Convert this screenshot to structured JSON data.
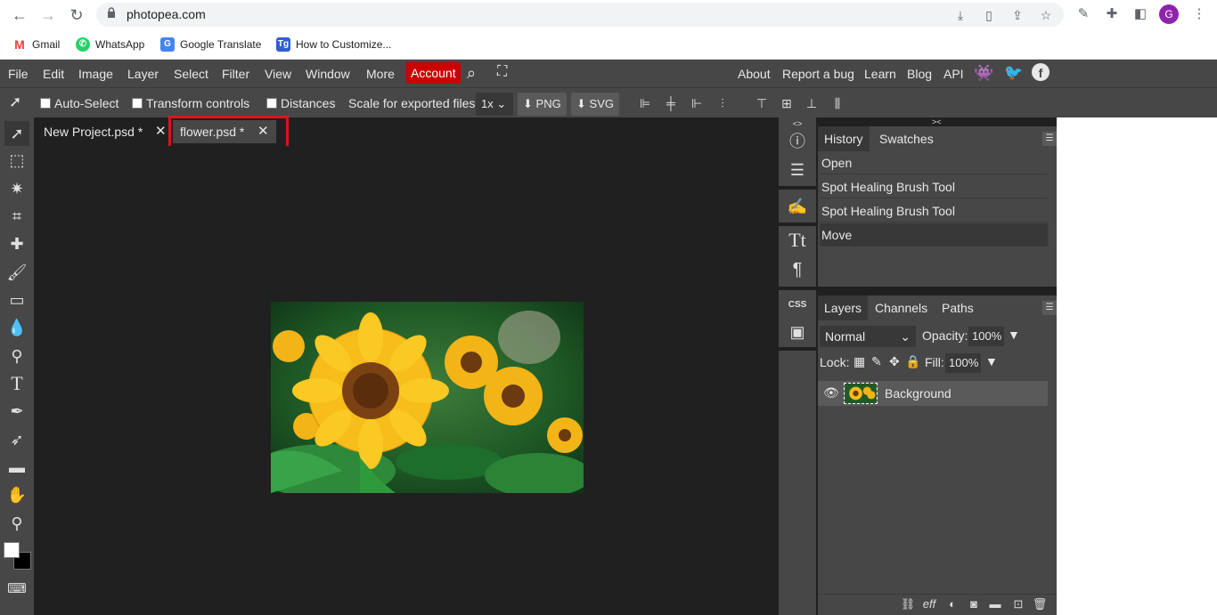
{
  "browser": {
    "url": "photopea.com",
    "profile_initial": "G",
    "bookmarks": [
      {
        "label": "Gmail",
        "icon": "gmail-icon",
        "color": "#ea4335"
      },
      {
        "label": "WhatsApp",
        "icon": "whatsapp-icon",
        "color": "#25d366"
      },
      {
        "label": "Google Translate",
        "icon": "google-translate-icon",
        "color": "#4285f4"
      },
      {
        "label": "How to Customize...",
        "icon": "tg-icon",
        "color": "#2f5fd0"
      }
    ]
  },
  "menubar": {
    "items": [
      "File",
      "Edit",
      "Image",
      "Layer",
      "Select",
      "Filter",
      "View",
      "Window",
      "More"
    ],
    "account": "Account",
    "right_links": [
      "About",
      "Report a bug",
      "Learn",
      "Blog",
      "API"
    ],
    "accent": "#cc0000"
  },
  "options": {
    "auto_select": "Auto-Select",
    "transform_controls": "Transform controls",
    "distances": "Distances",
    "scale_label": "Scale for exported files:",
    "scale_value": "1x",
    "png": "PNG",
    "svg": "SVG"
  },
  "tabs": [
    {
      "label": "New Project.psd *",
      "close": "✕"
    },
    {
      "label": "flower.psd *",
      "close": "✕"
    }
  ],
  "history": {
    "tabs": [
      "History",
      "Swatches"
    ],
    "items": [
      "Open",
      "Spot Healing Brush Tool",
      "Spot Healing Brush Tool",
      "Move"
    ]
  },
  "layers": {
    "tabs": [
      "Layers",
      "Channels",
      "Paths"
    ],
    "blend_mode": "Normal",
    "opacity_label": "Opacity:",
    "opacity_value": "100%",
    "lock_label": "Lock:",
    "fill_label": "Fill:",
    "fill_value": "100%",
    "layer_name": "Background"
  },
  "side_strip": {
    "css_label": "CSS"
  }
}
